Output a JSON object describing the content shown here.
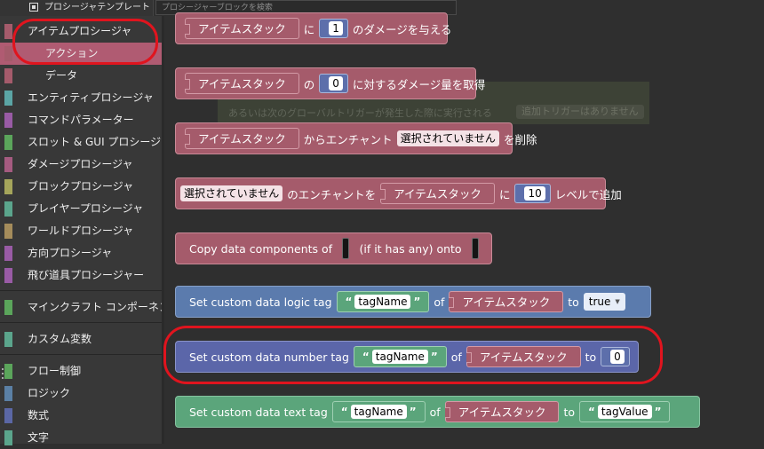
{
  "topbar": {
    "template_label": "プロシージャテンプレート",
    "search_placeholder": "プロシージャーブロックを検索"
  },
  "sidebar": {
    "items": [
      {
        "label": "アイテムプロシージャ",
        "color": "#a55b6b"
      },
      {
        "label": "アクション",
        "color": "#a55b6b"
      },
      {
        "label": "データ",
        "color": "#a55b6b"
      },
      {
        "label": "エンティティプロシージャ",
        "color": "#5ba5a5"
      },
      {
        "label": "コマンドパラメーター",
        "color": "#995ba5"
      },
      {
        "label": "スロット & GUI プロシージャ",
        "color": "#5ba55b"
      },
      {
        "label": "ダメージプロシージャ",
        "color": "#a55b80"
      },
      {
        "label": "ブロックプロシージャ",
        "color": "#a5a55b"
      },
      {
        "label": "プレイヤープロシージャ",
        "color": "#5ba58c"
      },
      {
        "label": "ワールドプロシージャ",
        "color": "#a58c5b"
      },
      {
        "label": "方向プロシージャ",
        "color": "#995ba5"
      },
      {
        "label": "飛び道具プロシージャー",
        "color": "#995ba5"
      },
      {
        "label": "マインクラフト コンポーネント",
        "color": "#5ba55b"
      },
      {
        "label": "カスタム変数",
        "color": "#5ba58c"
      },
      {
        "label": "フロー制御",
        "color": "#5ba55b"
      },
      {
        "label": "ロジック",
        "color": "#5b80a5"
      },
      {
        "label": "数式",
        "color": "#5b67a5"
      },
      {
        "label": "文字",
        "color": "#5ba58c"
      }
    ]
  },
  "ghost": {
    "text": "あるいは次のグローバルトリガーが発生した際に実行される",
    "pill": "追加トリガーはありません"
  },
  "blocks": {
    "b1": {
      "item": "アイテムスタック",
      "t1": "に",
      "num": "1",
      "t2": "のダメージを与える"
    },
    "b2": {
      "item": "アイテムスタック",
      "t1": "の",
      "num": "0",
      "t2": "に対するダメージ量を取得"
    },
    "b3": {
      "item": "アイテムスタック",
      "t1": "からエンチャント",
      "sel": "選択されていません",
      "t2": "を削除"
    },
    "b4": {
      "sel": "選択されていません",
      "t1": "のエンチャントを",
      "item": "アイテムスタック",
      "t2": "に",
      "num": "10",
      "t3": "レベルで追加"
    },
    "b5": {
      "t1": "Copy data components of",
      "t2": "(if it has any) onto"
    },
    "b6": {
      "t1": "Set custom data logic tag",
      "tag": "tagName",
      "t2": "of",
      "item": "アイテムスタック",
      "t3": "to",
      "val": "true"
    },
    "b7": {
      "t1": "Set custom data number tag",
      "tag": "tagName",
      "t2": "of",
      "item": "アイテムスタック",
      "t3": "to",
      "num": "0"
    },
    "b8": {
      "t1": "Set custom data text tag",
      "tag": "tagName",
      "t2": "of",
      "item": "アイテムスタック",
      "t3": "to",
      "val": "tagValue"
    }
  },
  "quote_open": "“",
  "quote_close": "”",
  "colors": {
    "item": "#a55b6b",
    "logic": "#5b7bad",
    "math": "#5b66a9",
    "text": "#5ba57b",
    "highlight": "#e0141e"
  }
}
